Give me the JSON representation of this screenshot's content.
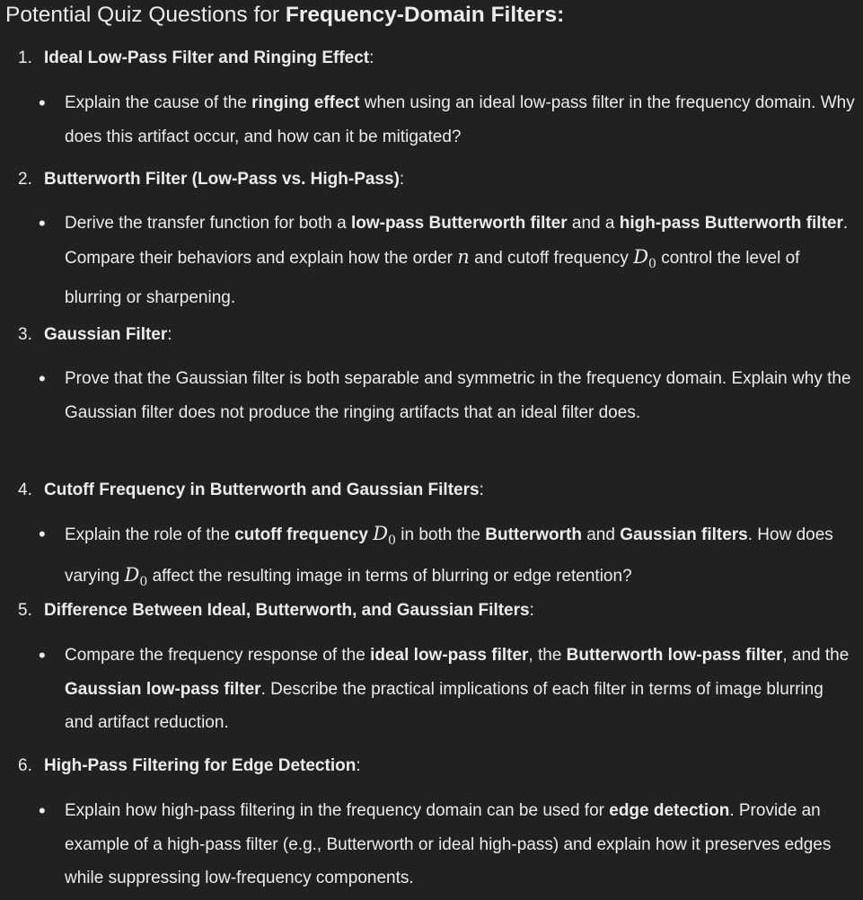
{
  "title": {
    "prefix": "Potential Quiz Questions for ",
    "bold": "Frequency-Domain Filters:"
  },
  "questions": [
    {
      "num": "1.",
      "title": "Ideal Low-Pass Filter and Ringing Effect",
      "colon": ":",
      "body": [
        {
          "t": "Explain the cause of the "
        },
        {
          "b": "ringing effect"
        },
        {
          "t": " when using an ideal low-pass filter in the frequency domain. Why does this artifact occur, and how can it be mitigated?"
        }
      ]
    },
    {
      "num": "2.",
      "title": "Butterworth Filter (Low-Pass vs. High-Pass)",
      "colon": ":",
      "body": [
        {
          "t": "Derive the transfer function for both a "
        },
        {
          "b": "low-pass Butterworth filter"
        },
        {
          "t": " and a "
        },
        {
          "b": "high-pass Butterworth filter"
        },
        {
          "t": ". Compare their behaviors and explain how the order "
        },
        {
          "m": "n"
        },
        {
          "t": " and cutoff frequency "
        },
        {
          "m": "D",
          "sub": "0"
        },
        {
          "t": " control the level of blurring or sharpening."
        }
      ]
    },
    {
      "num": "3.",
      "title": "Gaussian Filter",
      "colon": ":",
      "body": [
        {
          "t": "Prove that the Gaussian filter is both separable and symmetric in the frequency domain. Explain why the Gaussian filter does not produce the ringing artifacts that an ideal filter does."
        }
      ]
    },
    {
      "num": "4.",
      "title": "Cutoff Frequency in Butterworth and Gaussian Filters",
      "colon": ":",
      "body": [
        {
          "t": "Explain the role of the "
        },
        {
          "b": "cutoff frequency "
        },
        {
          "m": "D",
          "sub": "0"
        },
        {
          "t": " in both the "
        },
        {
          "b": "Butterworth"
        },
        {
          "t": " and "
        },
        {
          "b": "Gaussian filters"
        },
        {
          "t": ". How does varying "
        },
        {
          "m": "D",
          "sub": "0"
        },
        {
          "t": " affect the resulting image in terms of blurring or edge retention?"
        }
      ]
    },
    {
      "num": "5.",
      "title": "Difference Between Ideal, Butterworth, and Gaussian Filters",
      "colon": ":",
      "body": [
        {
          "t": "Compare the frequency response of the "
        },
        {
          "b": "ideal low-pass filter"
        },
        {
          "t": ", the "
        },
        {
          "b": "Butterworth low-pass filter"
        },
        {
          "t": ", and the "
        },
        {
          "b": "Gaussian low-pass filter"
        },
        {
          "t": ". Describe the practical implications of each filter in terms of image blurring and artifact reduction."
        }
      ]
    },
    {
      "num": "6.",
      "title": "High-Pass Filtering for Edge Detection",
      "colon": ":",
      "body": [
        {
          "t": "Explain how high-pass filtering in the frequency domain can be used for "
        },
        {
          "b": "edge detection"
        },
        {
          "t": ". Provide an example of a high-pass filter (e.g., Butterworth or ideal high-pass) and explain how it preserves edges while suppressing low-frequency components."
        }
      ]
    }
  ],
  "bullet_glyph": "•"
}
